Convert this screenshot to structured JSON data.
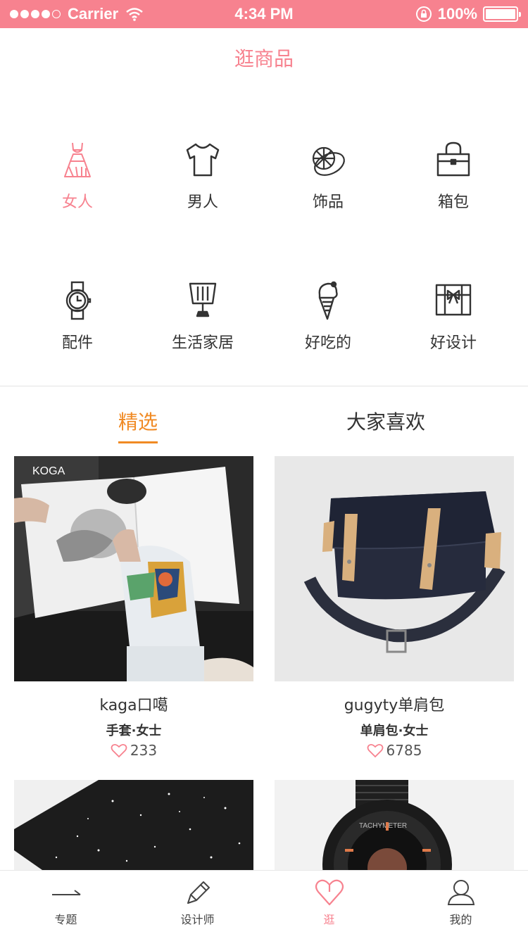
{
  "status_bar": {
    "carrier": "Carrier",
    "time": "4:34 PM",
    "battery": "100%",
    "battery_level": 1.0
  },
  "header": {
    "title": "逛商品"
  },
  "categories": [
    {
      "label": "女人",
      "icon": "dress-icon"
    },
    {
      "label": "男人",
      "icon": "tshirt-icon"
    },
    {
      "label": "饰品",
      "icon": "ring-icon"
    },
    {
      "label": "箱包",
      "icon": "handbag-icon"
    },
    {
      "label": "配件",
      "icon": "watch-icon"
    },
    {
      "label": "生活家居",
      "icon": "lamp-icon"
    },
    {
      "label": "好吃的",
      "icon": "ice-cream-icon"
    },
    {
      "label": "好设计",
      "icon": "gift-box-icon"
    }
  ],
  "tabs": {
    "selected": "精选",
    "popular": "大家喜欢"
  },
  "products": [
    {
      "name": "kaga口噶",
      "category": "手套·女士",
      "likes": "233",
      "image": "glove-book-photo"
    },
    {
      "name": "gugyty单肩包",
      "category": "单肩包·女士",
      "likes": "6785",
      "image": "navy-bag-photo"
    },
    {
      "image": "speckled-notebook-photo"
    },
    {
      "image": "black-watch-photo"
    }
  ],
  "photo_text": {
    "koga": "KOGA",
    "tachymeter": "TACHYMETER"
  },
  "tabbar": [
    {
      "label": "专题",
      "icon": "line-icon"
    },
    {
      "label": "设计师",
      "icon": "pencil-icon"
    },
    {
      "label": "逛",
      "icon": "heart-icon"
    },
    {
      "label": "我的",
      "icon": "person-icon"
    }
  ],
  "colors": {
    "accent": "#f7828f",
    "tab_active": "#f08a24",
    "text": "#333333"
  }
}
